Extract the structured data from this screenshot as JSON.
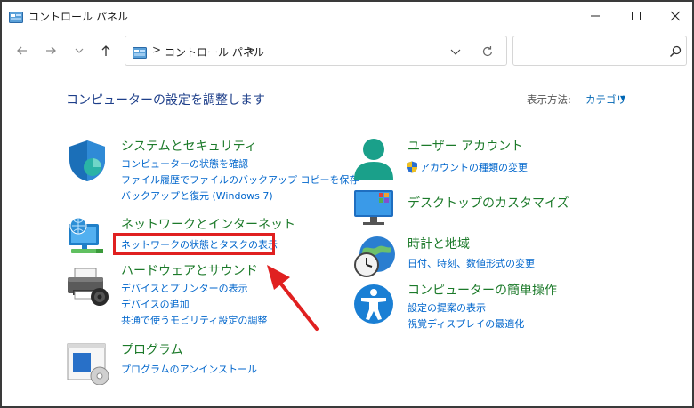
{
  "window": {
    "title": "コントロール パネル"
  },
  "addressbar": {
    "separator": ">",
    "path_label": "コントロール パネル"
  },
  "search": {
    "placeholder": ""
  },
  "main": {
    "heading": "コンピューターの設定を調整します",
    "view_label": "表示方法:",
    "view_value": "カテゴリ",
    "categories": [
      {
        "title": "システムとセキュリティ",
        "icon": "shield-icon",
        "links": [
          "コンピューターの状態を確認",
          "ファイル履歴でファイルのバックアップ コピーを保存",
          "バックアップと復元 (Windows 7)"
        ]
      },
      {
        "title": "ネットワークとインターネット",
        "icon": "network-icon",
        "links": [
          "ネットワークの状態とタスクの表示"
        ]
      },
      {
        "title": "ハードウェアとサウンド",
        "icon": "printer-icon",
        "links": [
          "デバイスとプリンターの表示",
          "デバイスの追加",
          "共通で使うモビリティ設定の調整"
        ]
      },
      {
        "title": "プログラム",
        "icon": "programs-icon",
        "links": [
          "プログラムのアンインストール"
        ]
      },
      {
        "title": "ユーザー アカウント",
        "icon": "user-icon",
        "links": [
          "アカウントの種類の変更"
        ]
      },
      {
        "title": "デスクトップのカスタマイズ",
        "icon": "desktop-icon",
        "links": []
      },
      {
        "title": "時計と地域",
        "icon": "clock-globe-icon",
        "links": [
          "日付、時刻、数値形式の変更"
        ]
      },
      {
        "title": "コンピューターの簡単操作",
        "icon": "accessibility-icon",
        "links": [
          "設定の提案の表示",
          "視覚ディスプレイの最適化"
        ]
      }
    ]
  },
  "colors": {
    "category_title": "#1c7a2a",
    "link": "#0066cc",
    "heading": "#1e3f8a",
    "annotation": "#e02020"
  }
}
